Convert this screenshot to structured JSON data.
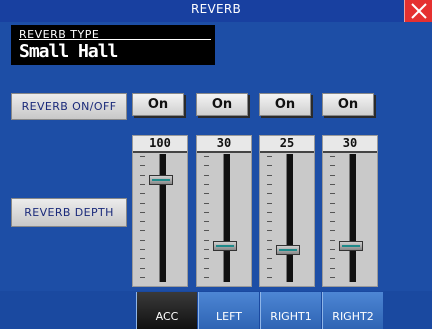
{
  "window": {
    "title": "REVERB"
  },
  "reverb_type": {
    "label": "REVERB TYPE",
    "value": "Small Hall"
  },
  "onoff": {
    "label": "REVERB ON/OFF",
    "buttons": [
      "On",
      "On",
      "On",
      "On"
    ]
  },
  "depth": {
    "label": "REVERB DEPTH",
    "values": [
      "100",
      "30",
      "25",
      "30"
    ],
    "max": 127
  },
  "tabs": [
    {
      "label": "ACC",
      "active": true
    },
    {
      "label": "LEFT",
      "active": false
    },
    {
      "label": "RIGHT1",
      "active": false
    },
    {
      "label": "RIGHT2",
      "active": false
    }
  ],
  "icons": {
    "close": "close-icon"
  },
  "colors": {
    "background": "#1d4ea6",
    "close": "#e53030",
    "thumb_stripe": "#1e8a8a"
  }
}
